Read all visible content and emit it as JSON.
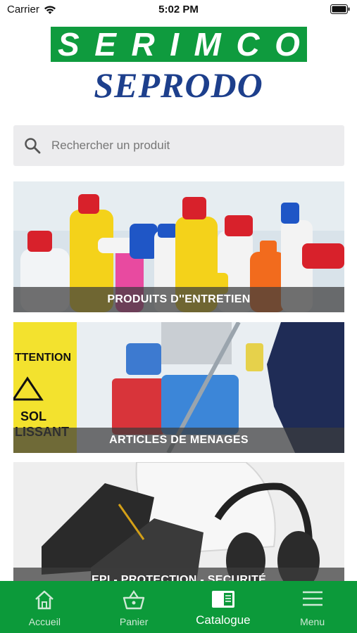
{
  "status_bar": {
    "carrier": "Carrier",
    "time": "5:02 PM"
  },
  "logo": {
    "top_word": "SERIMCO",
    "bottom_word": "SEPRODO"
  },
  "search": {
    "placeholder": "Rechercher un produit"
  },
  "categories": [
    {
      "label": "PRODUITS D''ENTRETIEN"
    },
    {
      "label": "ARTICLES DE MENAGES"
    },
    {
      "label": "EPI - PROTECTION - SECURITÉ"
    }
  ],
  "sign_text": {
    "line1": "TTENTION",
    "line2": "SOL",
    "line3": "LISSANT"
  },
  "tabbar": {
    "items": [
      {
        "label": "Accueil",
        "icon": "home-icon"
      },
      {
        "label": "Panier",
        "icon": "basket-icon"
      },
      {
        "label": "Catalogue",
        "icon": "catalogue-icon",
        "active": true
      },
      {
        "label": "Menu",
        "icon": "menu-icon"
      }
    ]
  },
  "colors": {
    "brand_green": "#0f9b3e",
    "brand_blue": "#1d3f8c",
    "tabbar_bg": "#0c9a3a"
  }
}
